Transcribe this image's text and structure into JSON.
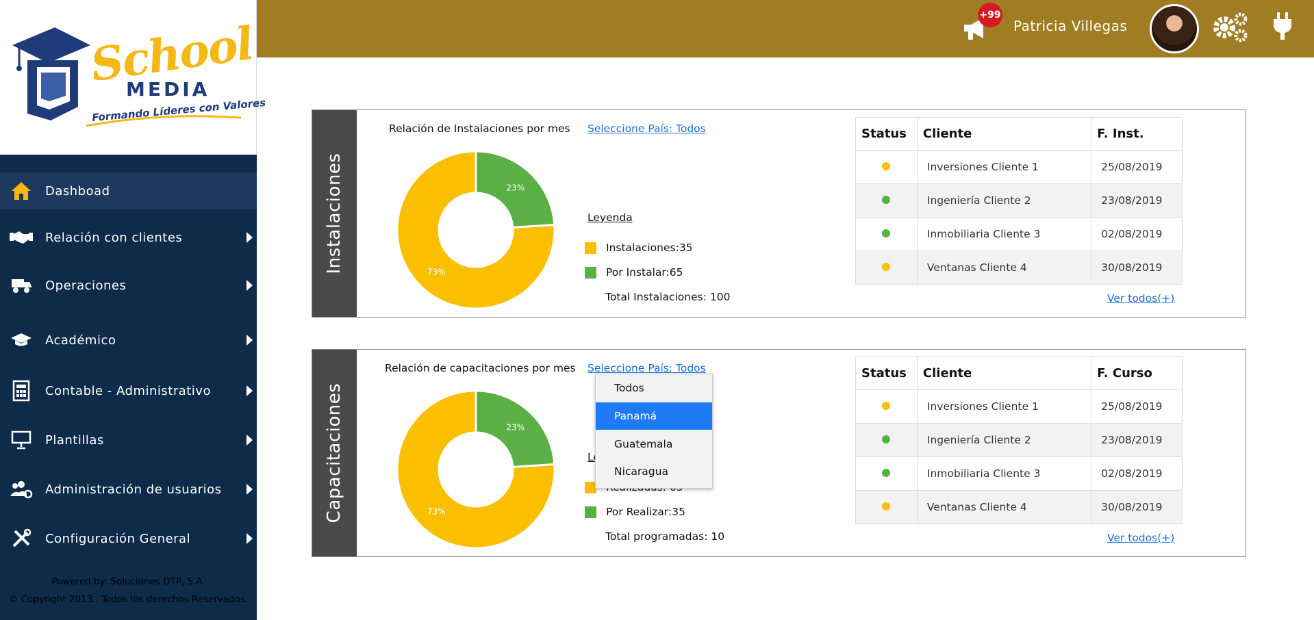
{
  "brand": {
    "logo_line1": "School",
    "logo_line2": "MEDIA",
    "tagline": "Formando Líderes con Valores"
  },
  "header": {
    "notification_badge": "+99",
    "user_name": "Patricia Villegas",
    "icons": [
      "megaphone-icon",
      "gears-icon",
      "plug-icon"
    ]
  },
  "sidebar": {
    "items": [
      {
        "label": "Dashboad",
        "icon": "home-icon",
        "active": true,
        "has_submenu": false
      },
      {
        "label": "Relación con clientes",
        "icon": "handshake-icon",
        "has_submenu": true
      },
      {
        "label": "Operaciones",
        "icon": "truck-icon",
        "has_submenu": true
      },
      {
        "label": "Académico",
        "icon": "graduation-cap-icon",
        "has_submenu": true
      },
      {
        "label": "Contable - Administrativo",
        "icon": "calculator-document-icon",
        "has_submenu": true
      },
      {
        "label": "Plantillas",
        "icon": "presentation-icon",
        "has_submenu": true
      },
      {
        "label": "Administración de usuarios",
        "icon": "users-gear-icon",
        "has_submenu": true
      },
      {
        "label": "Configuración General",
        "icon": "tools-icon",
        "has_submenu": true
      }
    ],
    "footer_powered": "Powered by: Soluciones DTP, S.A.",
    "footer_copyright": "© Copyright 2013.. Todos los derechos Reservados."
  },
  "panels": [
    {
      "side_title": "Instalaciones",
      "chart_title": "Relación de Instalaciones por mes",
      "country_link": "Seleccione País: Todos",
      "legend_title": "Leyenda",
      "legend_items": [
        {
          "label": "Instalaciones:35",
          "color": "#fbbf00"
        },
        {
          "label": "Por Instalar:65",
          "color": "#5aaf45"
        }
      ],
      "total": "Total Instalaciones: 100",
      "table": {
        "headers": [
          "Status",
          "Cliente",
          "F. Inst."
        ],
        "rows": [
          {
            "status_color": "#fbbf00",
            "cliente": "Inversiones Cliente 1",
            "fecha": "25/08/2019"
          },
          {
            "status_color": "#5aaf45",
            "cliente": "Ingeniería Cliente 2",
            "fecha": "23/08/2019"
          },
          {
            "status_color": "#5aaf45",
            "cliente": "Inmobiliaria Cliente 3",
            "fecha": "02/08/2019"
          },
          {
            "status_color": "#fbbf00",
            "cliente": "Ventanas Cliente 4",
            "fecha": "30/08/2019"
          }
        ]
      },
      "ver_todos": "Ver todos(+)"
    },
    {
      "side_title": "Capacitaciones",
      "chart_title": "Relación de capacitaciones por mes",
      "country_link": "Seleccione País: Todos",
      "legend_title": "Leyenda",
      "legend_items": [
        {
          "label": "Realizadas: 65",
          "color": "#fbbf00"
        },
        {
          "label": "Por Realizar:35",
          "color": "#5aaf45"
        }
      ],
      "total": "Total programadas: 10",
      "table": {
        "headers": [
          "Status",
          "Cliente",
          "F. Curso"
        ],
        "rows": [
          {
            "status_color": "#fbbf00",
            "cliente": "Inversiones Cliente 1",
            "fecha": "25/08/2019"
          },
          {
            "status_color": "#5aaf45",
            "cliente": "Ingeniería Cliente 2",
            "fecha": "23/08/2019"
          },
          {
            "status_color": "#5aaf45",
            "cliente": "Inmobiliaria Cliente 3",
            "fecha": "02/08/2019"
          },
          {
            "status_color": "#fbbf00",
            "cliente": "Ventanas Cliente 4",
            "fecha": "30/08/2019"
          }
        ]
      },
      "ver_todos": "Ver todos(+)"
    }
  ],
  "country_dropdown": {
    "options": [
      "Todos",
      "Panamá",
      "Guatemala",
      "Nicaragua"
    ],
    "selected": "Panamá"
  },
  "chart_data": [
    {
      "type": "pie",
      "title": "Relación de Instalaciones por mes",
      "categories": [
        "Por Instalar",
        "Instalaciones"
      ],
      "values": [
        23,
        73
      ],
      "labels": [
        "23%",
        "73%"
      ],
      "colors": [
        "#5aaf45",
        "#fbbf00"
      ]
    },
    {
      "type": "pie",
      "title": "Relación de capacitaciones por mes",
      "categories": [
        "Por Realizar",
        "Realizadas"
      ],
      "values": [
        23,
        73
      ],
      "labels": [
        "23%",
        "73%"
      ],
      "colors": [
        "#5aaf45",
        "#fbbf00"
      ]
    }
  ],
  "colors": {
    "sidebar_bg": "#0f2b4a",
    "topbar_bg": "#a07d22",
    "accent_yellow": "#fbbf00",
    "accent_green": "#5aaf45",
    "link_blue": "#1a6fd6"
  }
}
